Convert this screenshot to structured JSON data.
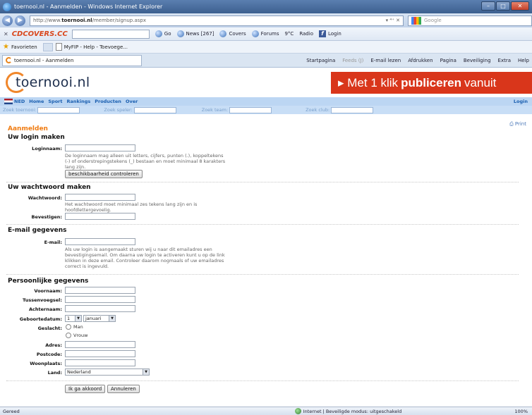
{
  "window": {
    "title": "toernooi.nl - Aanmelden - Windows Internet Explorer",
    "minimize": "–",
    "maximize": "□",
    "close": "✕"
  },
  "address": {
    "url_prefix": "http://www.",
    "url_domain": "toernooi.nl",
    "url_path": "/member/signup.aspx",
    "icons": "▾  ⁴⁺  ✕",
    "search_placeholder": "Google"
  },
  "toolbar": {
    "brand_left": "CD",
    "brand_right": "COVERS.CC",
    "go": "Go",
    "news": "News [267]",
    "covers": "Covers",
    "forums": "Forums",
    "temp": "9°C",
    "radio": "Radio",
    "login": "Login"
  },
  "favorites": {
    "label": "Favorieten",
    "item1": "MyFIP - Help - Toevoege..."
  },
  "tab": {
    "label": "toernooi.nl - Aanmelden",
    "startpagina": "Startpagina",
    "feeds": "Feeds (J)",
    "email": "E-mail lezen",
    "print": "Afdrukken",
    "pagina": "Pagina",
    "beveiliging": "Beveiliging",
    "extra": "Extra",
    "help": "Help"
  },
  "site": {
    "logo": "toernooi.nl",
    "banner_pre": "▸ Met 1 klik",
    "banner_bold": "publiceren",
    "banner_post": "vanuit",
    "nav": {
      "lang": "NED",
      "items": [
        "Home",
        "Sport",
        "Rankings",
        "Producten",
        "Over"
      ],
      "login": "Login"
    },
    "search": {
      "tournament": "Zoek toernooi:",
      "player": "Zoek speler:",
      "team": "Zoek team:",
      "club": "Zoek club:"
    },
    "print": "Print"
  },
  "form": {
    "heading": "Aanmelden",
    "login": {
      "title": "Uw login maken",
      "username_label": "Loginnaam:",
      "username_help": "De loginnaam mag alleen uit letters, cijfers, punten (.), koppeltekens (-) of onderstrepingstekens (_) bestaan en moet minimaal 8 karakters lang zijn.",
      "check_button": "beschikbaarheid controleren"
    },
    "password": {
      "title": "Uw wachtwoord maken",
      "password_label": "Wachtwoord:",
      "password_help": "Het wachtwoord moet minimaal zes tekens lang zijn en is hoofdlettergevoelig.",
      "confirm_label": "Bevestigen:"
    },
    "email": {
      "title": "E-mail gegevens",
      "email_label": "E-mail:",
      "email_help": "Als uw login is aangemaakt sturen wij u naar dit emailadres een bevestigingsemail. Om daarna uw login te activeren kunt u op de link klikken in deze email. Controleer daarom nogmaals of uw emailadres correct is ingevuld."
    },
    "personal": {
      "title": "Persoonlijke gegevens",
      "firstname_label": "Voornaam:",
      "middlename_label": "Tussenvoegsel:",
      "lastname_label": "Achternaam:",
      "birthdate_label": "Geboortedatum:",
      "birth_day": "1",
      "birth_month": "januari",
      "birth_year": "",
      "gender_label": "Geslacht:",
      "gender_male": "Man",
      "gender_female": "Vrouw",
      "address_label": "Adres:",
      "postcode_label": "Postcode:",
      "city_label": "Woonplaats:",
      "country_label": "Land:",
      "country_value": "Nederland"
    },
    "agree_button": "Ik ga akkoord",
    "cancel_button": "Annuleren"
  },
  "status": {
    "left": "Gereed",
    "zone": "Internet | Beveiligde modus: uitgeschakeld",
    "zoom": "100%"
  }
}
